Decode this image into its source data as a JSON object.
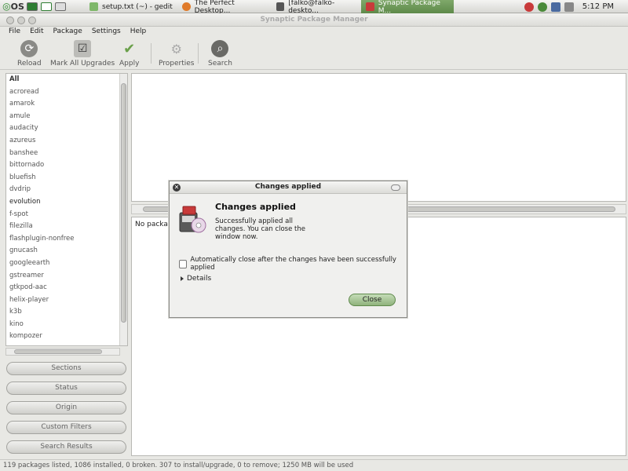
{
  "panel": {
    "os_label": "OS",
    "tasks": [
      {
        "label": "setup.txt (~) - gedit"
      },
      {
        "label": "The Perfect Desktop..."
      },
      {
        "label": "[falko@falko-deskto..."
      },
      {
        "label": "Synaptic Package M..."
      }
    ],
    "clock": "5:12 PM",
    "colors": {
      "accent": "#6a9a55"
    }
  },
  "window": {
    "title": "Synaptic Package Manager",
    "menu": [
      "File",
      "Edit",
      "Package",
      "Settings",
      "Help"
    ],
    "toolbar": {
      "reload": "Reload",
      "mark_all": "Mark All Upgrades",
      "apply": "Apply",
      "properties": "Properties",
      "search": "Search"
    }
  },
  "sections": {
    "items": [
      "All",
      "acroread",
      "amarok",
      "amule",
      "audacity",
      "azureus",
      "banshee",
      "bittornado",
      "bluefish",
      "dvdrip",
      "evolution",
      "f-spot",
      "filezilla",
      "flashplugin-nonfree",
      "gnucash",
      "googleearth",
      "gstreamer",
      "gtkpod-aac",
      "helix-player",
      "k3b",
      "kino",
      "kompozer"
    ]
  },
  "filters": {
    "sections": "Sections",
    "status": "Status",
    "origin": "Origin",
    "custom": "Custom Filters",
    "search_results": "Search Results"
  },
  "details": {
    "no_package": "No package"
  },
  "statusbar": {
    "text": "119 packages listed, 1086 installed, 0 broken. 307 to install/upgrade, 0 to remove; 1250 MB will be used"
  },
  "dialog": {
    "title": "Changes applied",
    "heading": "Changes applied",
    "message": "Successfully applied all changes. You can close the window now.",
    "auto_close_label": "Automatically close after the changes have been successfully applied",
    "details_label": "Details",
    "close_label": "Close"
  }
}
